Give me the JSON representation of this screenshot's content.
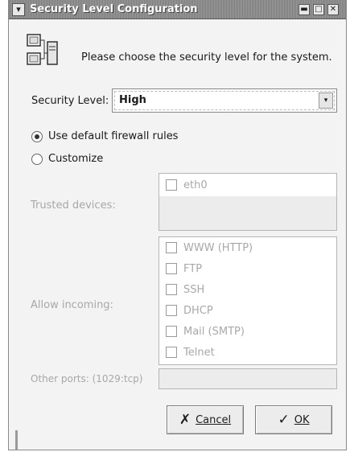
{
  "window": {
    "title": "Security Level Configuration",
    "buttons": {
      "menu": "▾",
      "minimize": "▬",
      "maximize": "□",
      "close": "✕"
    }
  },
  "header": {
    "text": "Please choose the security level for the system."
  },
  "security_level": {
    "label": "Security Level:",
    "value": "High",
    "dropdown_icon": "▾"
  },
  "firewall_rules": {
    "options": [
      {
        "label": "Use default firewall rules",
        "selected": true
      },
      {
        "label": "Customize",
        "selected": false
      }
    ]
  },
  "trusted_devices": {
    "label": "Trusted devices:",
    "items": [
      "eth0"
    ]
  },
  "allow_incoming": {
    "label": "Allow incoming:",
    "items": [
      "WWW (HTTP)",
      "FTP",
      "SSH",
      "DHCP",
      "Mail (SMTP)",
      "Telnet"
    ]
  },
  "other_ports": {
    "label": "Other ports: (1029:tcp)",
    "value": ""
  },
  "actions": {
    "cancel": "Cancel",
    "ok": "OK"
  },
  "colors": {
    "window_bg": "#f3f3f3",
    "disabled_text": "#a8a8a8",
    "titlebar": "#8a8a8a"
  },
  "icons": {
    "header": "computer-network-icon",
    "cancel": "cancel-x-icon",
    "ok": "ok-check-icon"
  }
}
